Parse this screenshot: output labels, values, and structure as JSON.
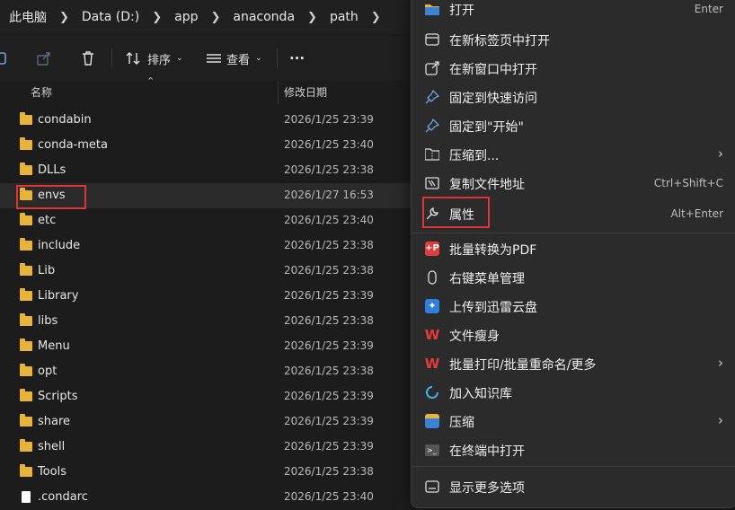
{
  "breadcrumb": [
    "此电脑",
    "Data (D:)",
    "app",
    "anaconda",
    "path"
  ],
  "toolbar": {
    "sort_label": "排序",
    "view_label": "查看",
    "more_label": "···"
  },
  "columns": {
    "name": "名称",
    "modified": "修改日期"
  },
  "files": [
    {
      "name": "condabin",
      "date": "2026/1/25 23:39",
      "type": "folder"
    },
    {
      "name": "conda-meta",
      "date": "2026/1/25 23:40",
      "type": "folder"
    },
    {
      "name": "DLLs",
      "date": "2026/1/25 23:38",
      "type": "folder"
    },
    {
      "name": "envs",
      "date": "2026/1/27 16:53",
      "type": "folder"
    },
    {
      "name": "etc",
      "date": "2026/1/25 23:40",
      "type": "folder"
    },
    {
      "name": "include",
      "date": "2026/1/25 23:38",
      "type": "folder"
    },
    {
      "name": "Lib",
      "date": "2026/1/25 23:38",
      "type": "folder"
    },
    {
      "name": "Library",
      "date": "2026/1/25 23:39",
      "type": "folder"
    },
    {
      "name": "libs",
      "date": "2026/1/25 23:38",
      "type": "folder"
    },
    {
      "name": "Menu",
      "date": "2026/1/25 23:39",
      "type": "folder"
    },
    {
      "name": "opt",
      "date": "2026/1/25 23:38",
      "type": "folder"
    },
    {
      "name": "Scripts",
      "date": "2026/1/25 23:39",
      "type": "folder"
    },
    {
      "name": "share",
      "date": "2026/1/25 23:39",
      "type": "folder"
    },
    {
      "name": "shell",
      "date": "2026/1/25 23:39",
      "type": "folder"
    },
    {
      "name": "Tools",
      "date": "2026/1/25 23:38",
      "type": "folder"
    },
    {
      "name": ".condarc",
      "date": "2026/1/25 23:40",
      "type": "file"
    }
  ],
  "selected_file": "envs",
  "context_menu": {
    "items": [
      {
        "label": "打开",
        "shortcut": "Enter",
        "icon": "folder-open-icon"
      },
      {
        "label": "在新标签页中打开",
        "shortcut": "",
        "icon": "new-tab-icon"
      },
      {
        "label": "在新窗口中打开",
        "shortcut": "",
        "icon": "new-window-icon"
      },
      {
        "label": "固定到快速访问",
        "shortcut": "",
        "icon": "pin-icon"
      },
      {
        "label": "固定到\"开始\"",
        "shortcut": "",
        "icon": "pin-icon"
      },
      {
        "label": "压缩到...",
        "shortcut": "",
        "icon": "zip-icon",
        "submenu": true
      },
      {
        "label": "复制文件地址",
        "shortcut": "Ctrl+Shift+C",
        "icon": "copy-path-icon"
      },
      {
        "label": "属性",
        "shortcut": "Alt+Enter",
        "icon": "wrench-icon"
      },
      {
        "label": "批量转换为PDF",
        "shortcut": "",
        "icon": "pdf-convert-icon"
      },
      {
        "label": "右键菜单管理",
        "shortcut": "",
        "icon": "menu-manage-icon"
      },
      {
        "label": "上传到迅雷云盘",
        "shortcut": "",
        "icon": "thunder-cloud-icon"
      },
      {
        "label": "文件瘦身",
        "shortcut": "",
        "icon": "wps-icon"
      },
      {
        "label": "批量打印/批量重命名/更多",
        "shortcut": "",
        "icon": "wps-icon",
        "submenu": true
      },
      {
        "label": "加入知识库",
        "shortcut": "",
        "icon": "knowledge-base-icon"
      },
      {
        "label": "压缩",
        "shortcut": "",
        "icon": "compress-icon",
        "submenu": true
      },
      {
        "label": "在终端中打开",
        "shortcut": "",
        "icon": "terminal-icon"
      },
      {
        "label": "显示更多选项",
        "shortcut": "",
        "icon": "more-options-icon"
      }
    ]
  },
  "colors": {
    "highlight_box": "#e03434",
    "folder": "#e8b339",
    "menu_bg": "#2b2b2b"
  }
}
